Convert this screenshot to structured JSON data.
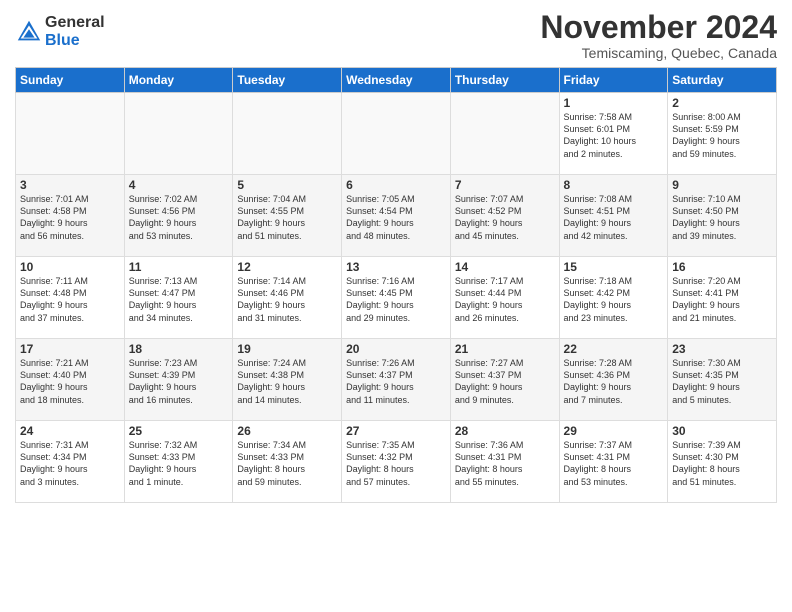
{
  "logo": {
    "general": "General",
    "blue": "Blue"
  },
  "title": "November 2024",
  "location": "Temiscaming, Quebec, Canada",
  "days_of_week": [
    "Sunday",
    "Monday",
    "Tuesday",
    "Wednesday",
    "Thursday",
    "Friday",
    "Saturday"
  ],
  "weeks": [
    [
      {
        "day": "",
        "info": ""
      },
      {
        "day": "",
        "info": ""
      },
      {
        "day": "",
        "info": ""
      },
      {
        "day": "",
        "info": ""
      },
      {
        "day": "",
        "info": ""
      },
      {
        "day": "1",
        "info": "Sunrise: 7:58 AM\nSunset: 6:01 PM\nDaylight: 10 hours\nand 2 minutes."
      },
      {
        "day": "2",
        "info": "Sunrise: 8:00 AM\nSunset: 5:59 PM\nDaylight: 9 hours\nand 59 minutes."
      }
    ],
    [
      {
        "day": "3",
        "info": "Sunrise: 7:01 AM\nSunset: 4:58 PM\nDaylight: 9 hours\nand 56 minutes."
      },
      {
        "day": "4",
        "info": "Sunrise: 7:02 AM\nSunset: 4:56 PM\nDaylight: 9 hours\nand 53 minutes."
      },
      {
        "day": "5",
        "info": "Sunrise: 7:04 AM\nSunset: 4:55 PM\nDaylight: 9 hours\nand 51 minutes."
      },
      {
        "day": "6",
        "info": "Sunrise: 7:05 AM\nSunset: 4:54 PM\nDaylight: 9 hours\nand 48 minutes."
      },
      {
        "day": "7",
        "info": "Sunrise: 7:07 AM\nSunset: 4:52 PM\nDaylight: 9 hours\nand 45 minutes."
      },
      {
        "day": "8",
        "info": "Sunrise: 7:08 AM\nSunset: 4:51 PM\nDaylight: 9 hours\nand 42 minutes."
      },
      {
        "day": "9",
        "info": "Sunrise: 7:10 AM\nSunset: 4:50 PM\nDaylight: 9 hours\nand 39 minutes."
      }
    ],
    [
      {
        "day": "10",
        "info": "Sunrise: 7:11 AM\nSunset: 4:48 PM\nDaylight: 9 hours\nand 37 minutes."
      },
      {
        "day": "11",
        "info": "Sunrise: 7:13 AM\nSunset: 4:47 PM\nDaylight: 9 hours\nand 34 minutes."
      },
      {
        "day": "12",
        "info": "Sunrise: 7:14 AM\nSunset: 4:46 PM\nDaylight: 9 hours\nand 31 minutes."
      },
      {
        "day": "13",
        "info": "Sunrise: 7:16 AM\nSunset: 4:45 PM\nDaylight: 9 hours\nand 29 minutes."
      },
      {
        "day": "14",
        "info": "Sunrise: 7:17 AM\nSunset: 4:44 PM\nDaylight: 9 hours\nand 26 minutes."
      },
      {
        "day": "15",
        "info": "Sunrise: 7:18 AM\nSunset: 4:42 PM\nDaylight: 9 hours\nand 23 minutes."
      },
      {
        "day": "16",
        "info": "Sunrise: 7:20 AM\nSunset: 4:41 PM\nDaylight: 9 hours\nand 21 minutes."
      }
    ],
    [
      {
        "day": "17",
        "info": "Sunrise: 7:21 AM\nSunset: 4:40 PM\nDaylight: 9 hours\nand 18 minutes."
      },
      {
        "day": "18",
        "info": "Sunrise: 7:23 AM\nSunset: 4:39 PM\nDaylight: 9 hours\nand 16 minutes."
      },
      {
        "day": "19",
        "info": "Sunrise: 7:24 AM\nSunset: 4:38 PM\nDaylight: 9 hours\nand 14 minutes."
      },
      {
        "day": "20",
        "info": "Sunrise: 7:26 AM\nSunset: 4:37 PM\nDaylight: 9 hours\nand 11 minutes."
      },
      {
        "day": "21",
        "info": "Sunrise: 7:27 AM\nSunset: 4:37 PM\nDaylight: 9 hours\nand 9 minutes."
      },
      {
        "day": "22",
        "info": "Sunrise: 7:28 AM\nSunset: 4:36 PM\nDaylight: 9 hours\nand 7 minutes."
      },
      {
        "day": "23",
        "info": "Sunrise: 7:30 AM\nSunset: 4:35 PM\nDaylight: 9 hours\nand 5 minutes."
      }
    ],
    [
      {
        "day": "24",
        "info": "Sunrise: 7:31 AM\nSunset: 4:34 PM\nDaylight: 9 hours\nand 3 minutes."
      },
      {
        "day": "25",
        "info": "Sunrise: 7:32 AM\nSunset: 4:33 PM\nDaylight: 9 hours\nand 1 minute."
      },
      {
        "day": "26",
        "info": "Sunrise: 7:34 AM\nSunset: 4:33 PM\nDaylight: 8 hours\nand 59 minutes."
      },
      {
        "day": "27",
        "info": "Sunrise: 7:35 AM\nSunset: 4:32 PM\nDaylight: 8 hours\nand 57 minutes."
      },
      {
        "day": "28",
        "info": "Sunrise: 7:36 AM\nSunset: 4:31 PM\nDaylight: 8 hours\nand 55 minutes."
      },
      {
        "day": "29",
        "info": "Sunrise: 7:37 AM\nSunset: 4:31 PM\nDaylight: 8 hours\nand 53 minutes."
      },
      {
        "day": "30",
        "info": "Sunrise: 7:39 AM\nSunset: 4:30 PM\nDaylight: 8 hours\nand 51 minutes."
      }
    ]
  ]
}
